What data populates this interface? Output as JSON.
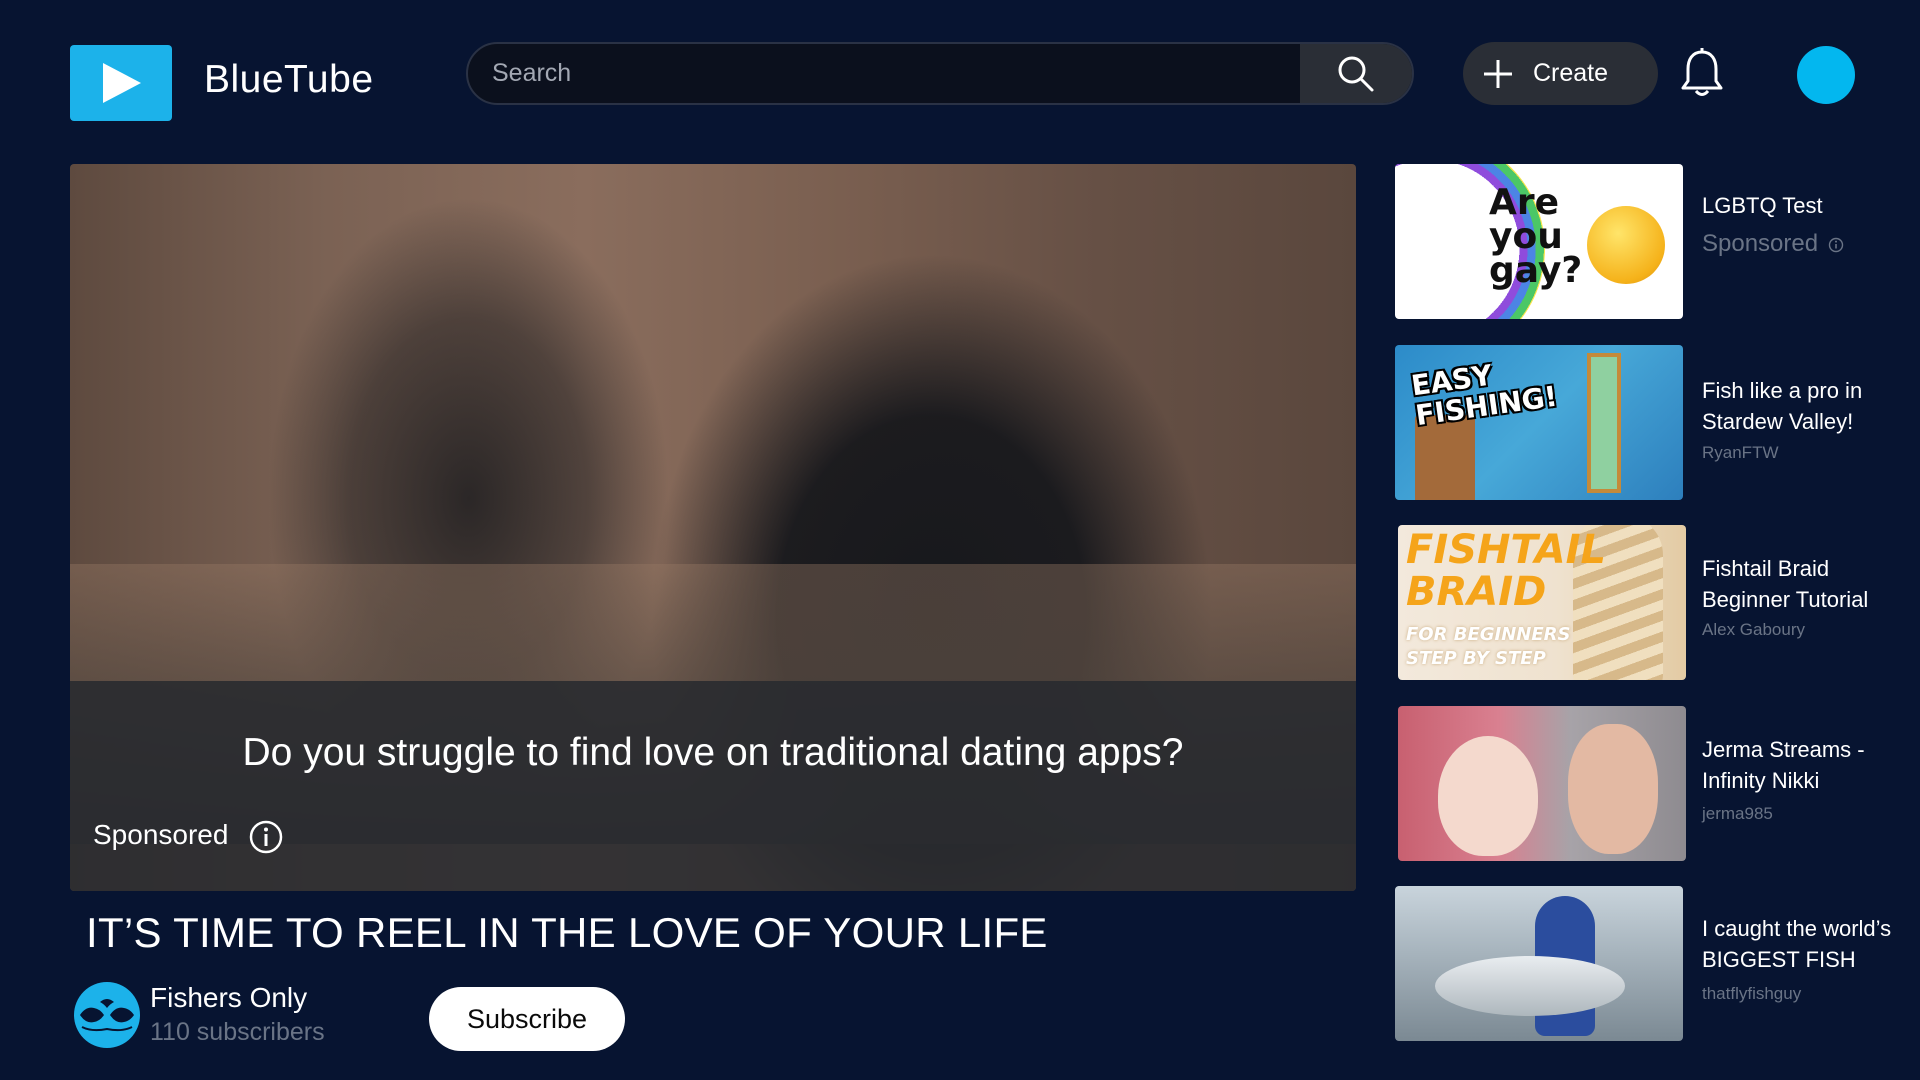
{
  "app": {
    "name": "BlueTube"
  },
  "header": {
    "search_placeholder": "Search",
    "create_label": "Create"
  },
  "video": {
    "caption": "Do you struggle to find love on traditional dating apps?",
    "sponsored_label": "Sponsored",
    "title": "IT’S TIME TO REEL IN THE LOVE OF YOUR LIFE"
  },
  "channel": {
    "name": "Fishers Only",
    "subscribers": "110 subscribers",
    "subscribe_label": "Subscribe"
  },
  "sidebar": {
    "items": [
      {
        "title": "LGBTQ Test",
        "meta": "Sponsored",
        "thumb_text": "Are you gay?"
      },
      {
        "title": "Fish like a pro in Stardew Valley!",
        "meta": "RyanFTW",
        "thumb_text": "EASY FISHING!"
      },
      {
        "title": "Fishtail Braid Beginner Tutorial",
        "meta": "Alex Gaboury",
        "thumb_text": "FISHTAIL BRAID",
        "thumb_subtext": "FOR BEGINNERS STEP BY STEP"
      },
      {
        "title": "Jerma Streams - Infinity Nikki",
        "meta": "jerma985"
      },
      {
        "title": "I caught the world’s BIGGEST FISH",
        "meta": "thatflyfishguy"
      }
    ]
  },
  "colors": {
    "background": "#071431",
    "accent": "#1cb2ea",
    "avatar": "#03b7ef",
    "muted_text": "#6a7486"
  },
  "icons": [
    "play-icon",
    "search-icon",
    "plus-icon",
    "bell-icon",
    "info-icon",
    "fish-logo-icon"
  ]
}
